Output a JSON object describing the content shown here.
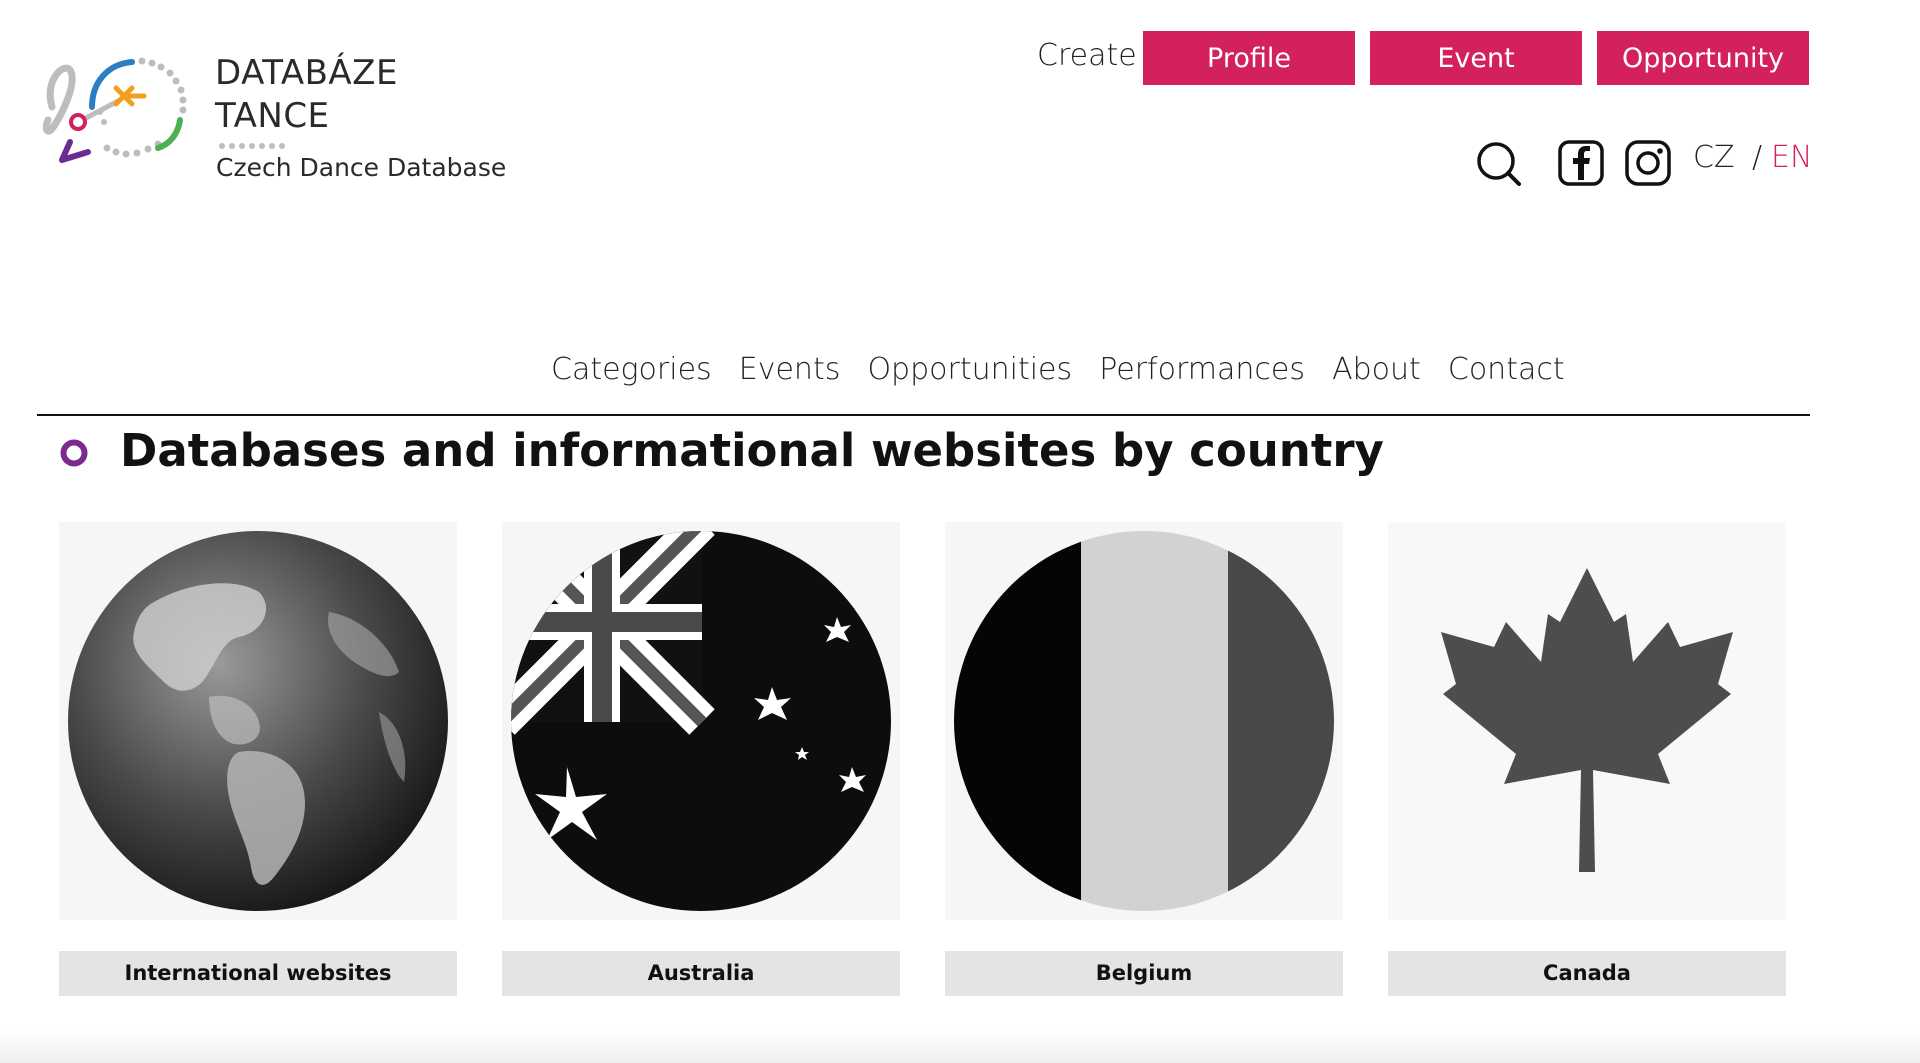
{
  "header": {
    "logo": {
      "title_line1": "DATABÁZE",
      "title_line2": "TANCE",
      "subtitle": "Czech Dance Database"
    },
    "create": {
      "label": "Create",
      "buttons": [
        "Profile",
        "Event",
        "Opportunity"
      ]
    },
    "utilities": {
      "icons": [
        "search-icon",
        "facebook-icon",
        "instagram-icon"
      ],
      "lang_cz": "CZ",
      "lang_separator": "/",
      "lang_en": "EN"
    }
  },
  "nav": {
    "items": [
      "Categories",
      "Events",
      "Opportunities",
      "Performances",
      "About",
      "Contact"
    ]
  },
  "main": {
    "title": "Databases and informational websites by country",
    "cards": [
      {
        "label": "International websites",
        "image": "globe"
      },
      {
        "label": "Australia",
        "image": "australia-flag"
      },
      {
        "label": "Belgium",
        "image": "belgium-flag"
      },
      {
        "label": "Canada",
        "image": "canada-flag"
      }
    ]
  },
  "colors": {
    "accent": "#d2215c",
    "heading_icon": "#7b2a8f",
    "label_bg": "#e4e4e4"
  }
}
